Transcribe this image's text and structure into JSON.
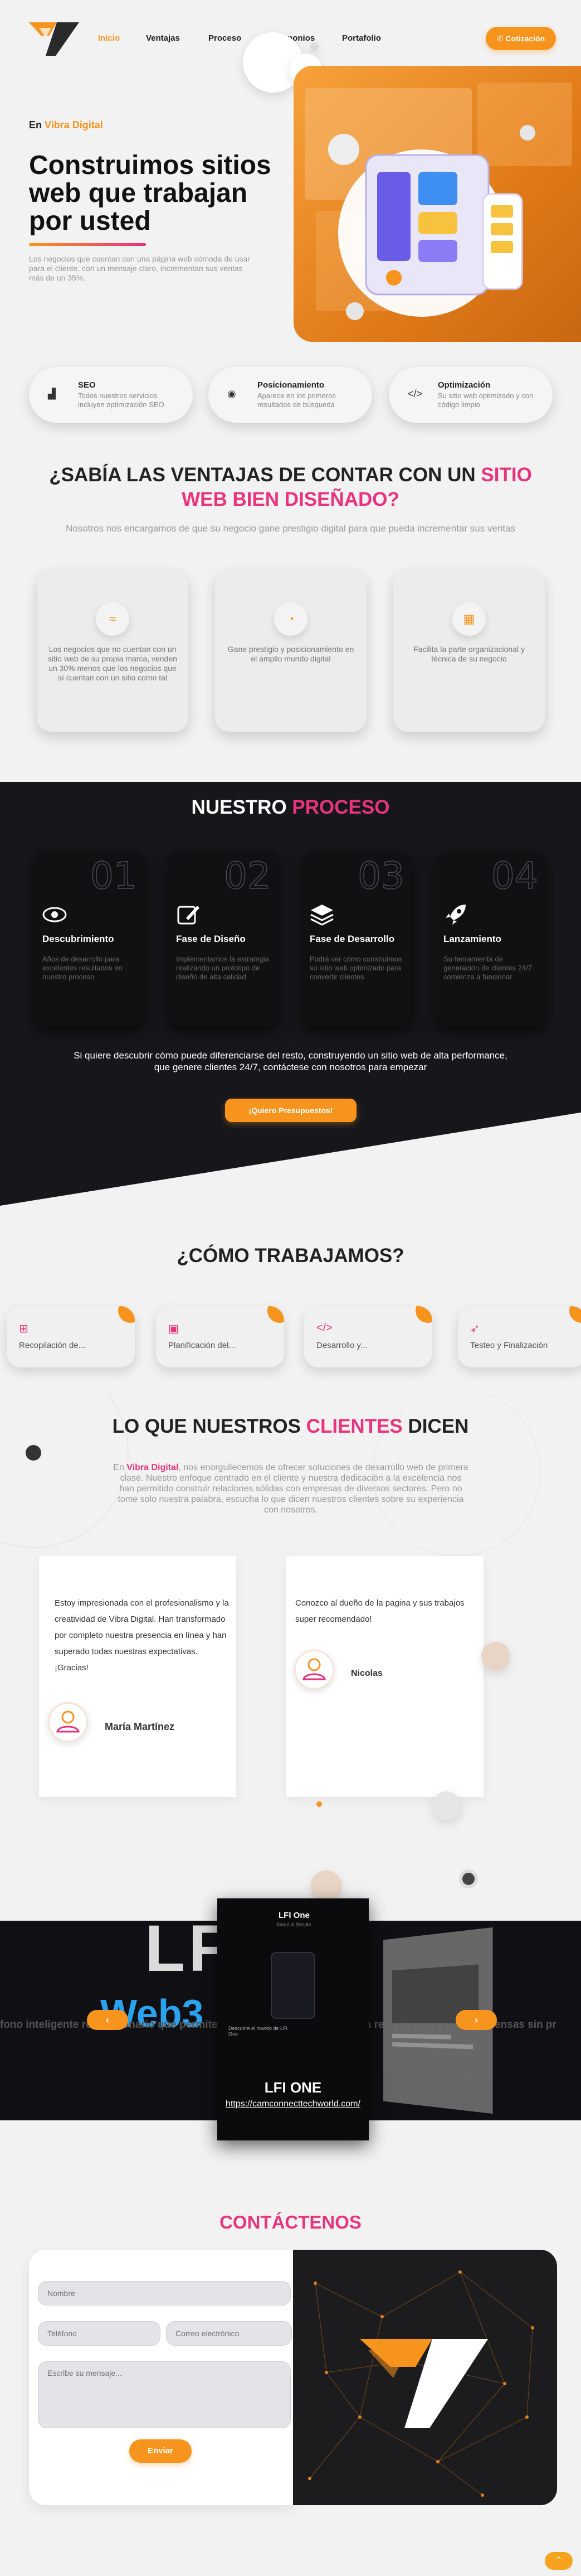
{
  "nav": {
    "links": [
      "Inicio",
      "Ventajas",
      "Proceso",
      "Testimonios",
      "Portafolio"
    ],
    "cta": "Cotización",
    "colors": {
      "accent": "#f7941d",
      "pink": "#e8337e"
    }
  },
  "hero": {
    "eyebrow_prefix": "En",
    "eyebrow_brand": "Vibra Digital",
    "title": "Construimos sitios web que trabajan por usted",
    "subtitle": "Los negocios que cuentan con una página web cómoda de usar para el cliente, con un mensaje claro, incrementan sus ventas más de un 35%."
  },
  "pills": [
    {
      "icon": "chart-icon",
      "title": "SEO",
      "desc": "Todos nuestros servicios incluyen optimización SEO"
    },
    {
      "icon": "globe-icon",
      "title": "Posicionamiento",
      "desc": "Aparece en los primeros resultados de búsqueda"
    },
    {
      "icon": "code-icon",
      "title": "Optimización",
      "desc": "Su sitio web optimizado y con código limpio"
    }
  ],
  "ventajas": {
    "title_a": "¿SABÍA LAS VENTAJAS DE CONTAR CON UN ",
    "title_b": "SITIO",
    "title_c": "WEB BIEN DISEÑADO?",
    "subtitle": "Nosotros nos encargamos de que su negocio gane prestigio digital para que pueda incrementar sus ventas",
    "cards": [
      {
        "icon": "trend-icon",
        "text": "Los negocios que no cuentan con un sitio web de su propia marca, venden un 30% menos que los negocios que sí cuentan con un sitio como tal"
      },
      {
        "icon": "gauge-icon",
        "text": "Gane prestigio y posicionamiento en el amplio mundo digital"
      },
      {
        "icon": "building-icon",
        "text": "Facilita la parte organizacional y técnica de su negocio"
      }
    ]
  },
  "proceso": {
    "title_a": "NUESTRO ",
    "title_b": "PROCESO",
    "steps": [
      {
        "num": "01",
        "icon": "eye-icon",
        "title": "Descubrimiento",
        "desc": "Años de desarrollo para excelentes resultados en nuestro proceso"
      },
      {
        "num": "02",
        "icon": "edit-icon",
        "title": "Fase de Diseño",
        "desc": "Implementamos la estrategia realizando un prototipo de diseño de alta calidad"
      },
      {
        "num": "03",
        "icon": "layers-icon",
        "title": "Fase de Desarrollo",
        "desc": "Podrá ver cómo construimos su sitio web optimizado para convertir clientes"
      },
      {
        "num": "04",
        "icon": "rocket-icon",
        "title": "Lanzamiento",
        "desc": "Su herramienta de generación de clientes 24/7 comienza a funcionar"
      }
    ],
    "text": "Si quiere descubrir cómo puede diferenciarse del resto, construyendo un sitio web de alta performance, que genere clientes 24/7, contáctese con nosotros para empezar",
    "cta": "¡Quiero Presupuestos!"
  },
  "como": {
    "title": "¿CÓMO TRABAJAMOS?",
    "items": [
      {
        "icon": "sitemap-icon",
        "label": "Recopilación de..."
      },
      {
        "icon": "calendar-icon",
        "label": "Planificación del..."
      },
      {
        "icon": "code-icon",
        "label": "Desarrollo y..."
      },
      {
        "icon": "rocket-icon",
        "label": "Testeo y Finalización"
      }
    ]
  },
  "testimonios": {
    "title_a": "LO QUE NUESTROS ",
    "title_b": "CLIENTES",
    "title_c": " DICEN",
    "intro_a": "En ",
    "intro_brand": "Vibra Digital",
    "intro_b": ", nos enorgullecemos de ofrecer soluciones de desarrollo web de primera clase. Nuestro enfoque centrado en el cliente y nuestra dedicación a la excelencia nos han permitido construir relaciones sólidas con empresas de diversos sectores. Pero no tome solo nuestra palabra, escucha lo que dicen nuestros clientes sobre su experiencia con nosotros.",
    "items": [
      {
        "text": "Estoy impresionada con el profesionalismo y la creatividad de Vibra Digital. Han transformado por completo nuestra presencia en línea y han superado todas nuestras expectativas. ¡Gracias!",
        "name": "María Martínez"
      },
      {
        "text": "Conozco al dueño de la pagina y sus trabajos super recomendado!",
        "name": "Nicolas"
      }
    ]
  },
  "portafolio": {
    "bg_word": "LFI",
    "web3_word": "Web3",
    "marquee": "fono inteligente revolucionario que permite a los usuarios conectarse a la red LFI y recibir recompensas sin pr",
    "mini_brand": "LFI One",
    "mini_sub": "Smart & Simple",
    "mini_text": "Descubre el mundo de LFI One",
    "project_title": "LFI ONE",
    "project_link": "https://camconnecttechworld.com/",
    "prev": "‹",
    "next": "›"
  },
  "contacto": {
    "title": "CONTÁCTENOS",
    "name_ph": "Nombre",
    "phone_ph": "Teléfono",
    "email_ph": "Correo electrónico",
    "msg_ph": "Escribe su mensaje...",
    "send": "Enviar"
  },
  "scroll_top": "⌃"
}
